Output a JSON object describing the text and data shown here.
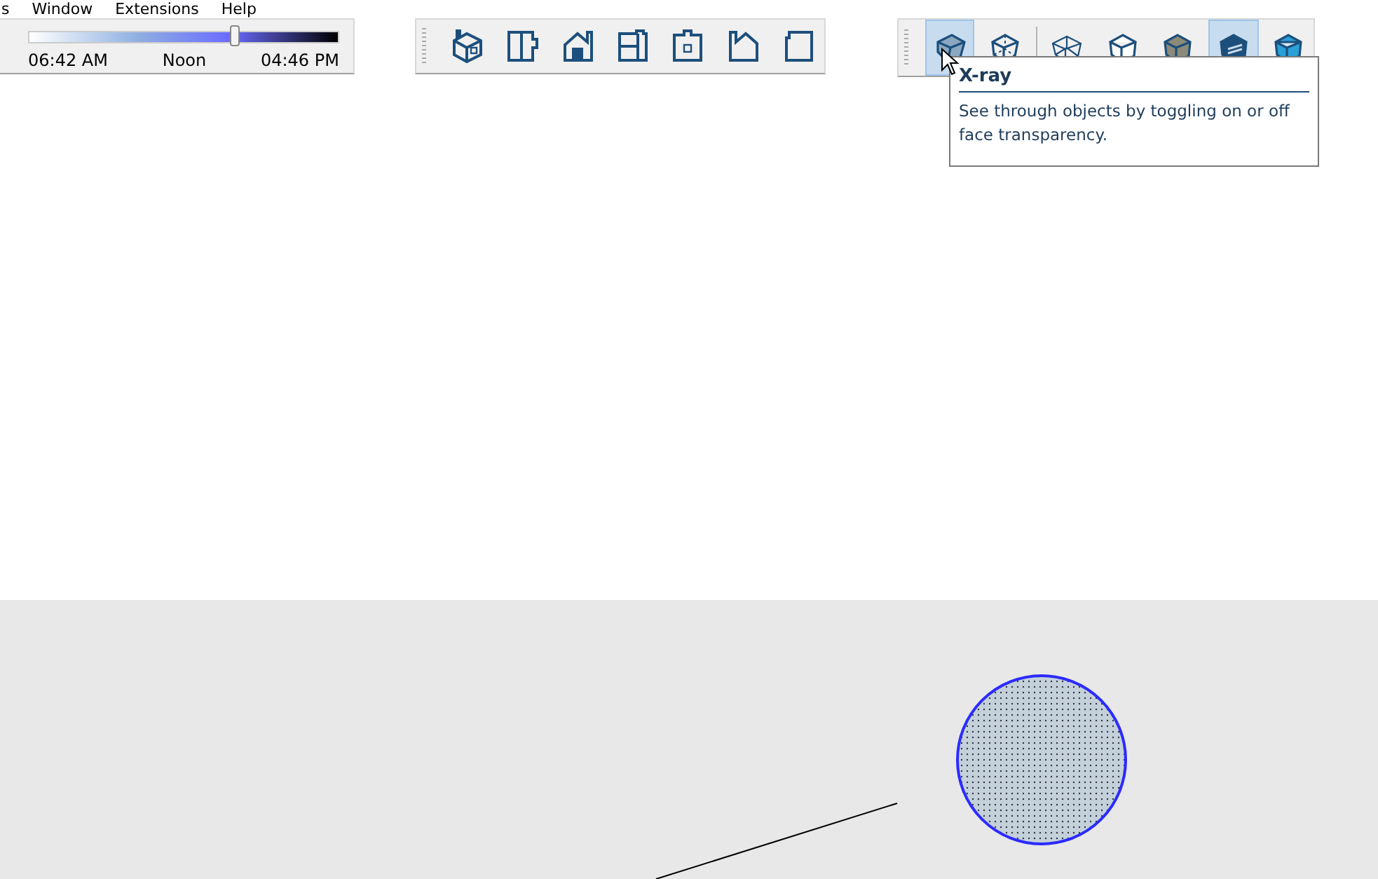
{
  "menu_bar": {
    "items": [
      "s",
      "Window",
      "Extensions",
      "Help"
    ]
  },
  "shadows_toolbar": {
    "time_slider": {
      "level": 0.67
    },
    "labels": [
      "06:42 AM",
      "Noon",
      "04:46 PM"
    ]
  },
  "views_toolbar": {
    "buttons": [
      {
        "kind": "iso"
      },
      {
        "kind": "top"
      },
      {
        "kind": "front"
      },
      {
        "kind": "right"
      },
      {
        "kind": "back"
      },
      {
        "kind": "left"
      },
      {
        "kind": "bottom"
      }
    ]
  },
  "styles_toolbar": {
    "buttons": [
      {
        "kind": "xray",
        "selected": true
      },
      {
        "kind": "backedges",
        "selected": false
      },
      {
        "kind": "wireframe",
        "selected": false
      },
      {
        "kind": "hiddenline",
        "selected": false
      },
      {
        "kind": "shaded",
        "selected": false
      },
      {
        "kind": "textured",
        "selected": true
      },
      {
        "kind": "monochrome",
        "selected": false
      }
    ]
  },
  "tooltip": {
    "title": "X-ray",
    "text": "See through objects by toggling on or off face transparency."
  }
}
